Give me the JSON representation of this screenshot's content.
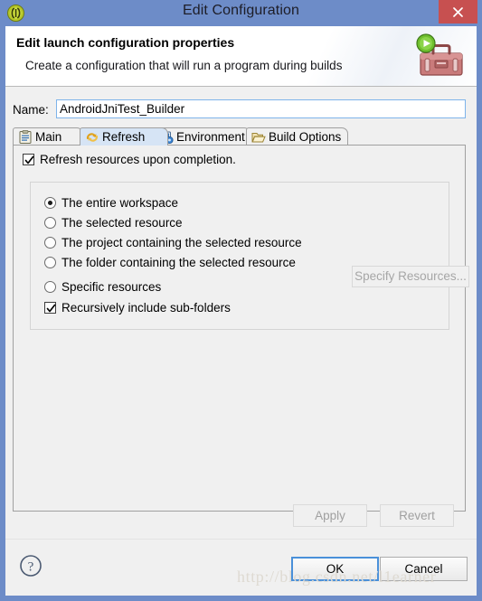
{
  "window": {
    "title": "Edit Configuration",
    "title_icon": "eclipse-logo-icon",
    "close_label": "×",
    "titlebar_color": "#6d8cc8",
    "close_color": "#c75050"
  },
  "header": {
    "title": "Edit launch configuration properties",
    "subtitle": "Create a configuration that will run a program during builds",
    "icon": "toolbox-with-play-icon"
  },
  "name_field": {
    "label": "Name:",
    "value": "AndroidJniTest_Builder",
    "placeholder": ""
  },
  "tabs": [
    {
      "label": "Main",
      "icon": "clipboard-icon",
      "selected": false
    },
    {
      "label": "Refresh",
      "icon": "refresh-icon",
      "selected": true
    },
    {
      "label": "Environment",
      "icon": "monitor-icon",
      "selected": false
    },
    {
      "label": "Build Options",
      "icon": "open-folder-icon",
      "selected": false
    }
  ],
  "refresh_tab": {
    "enable_checkbox": {
      "label": "Refresh resources upon completion.",
      "checked": true
    },
    "scope_options": [
      {
        "label": "The entire workspace",
        "selected": true
      },
      {
        "label": "The selected resource",
        "selected": false
      },
      {
        "label": "The project containing the selected resource",
        "selected": false
      },
      {
        "label": "The folder containing the selected resource",
        "selected": false
      },
      {
        "label": "Specific resources",
        "selected": false
      }
    ],
    "specify_resources_button": {
      "label": "Specify Resources...",
      "enabled": false
    },
    "recursive_checkbox": {
      "label": "Recursively include sub-folders",
      "checked": true
    }
  },
  "action_buttons": {
    "apply": "Apply",
    "revert": "Revert"
  },
  "footer": {
    "help_icon": "help-question-icon",
    "ok": "OK",
    "cancel": "Cancel"
  },
  "watermark": "http://blog.csdn.net/l1earner"
}
